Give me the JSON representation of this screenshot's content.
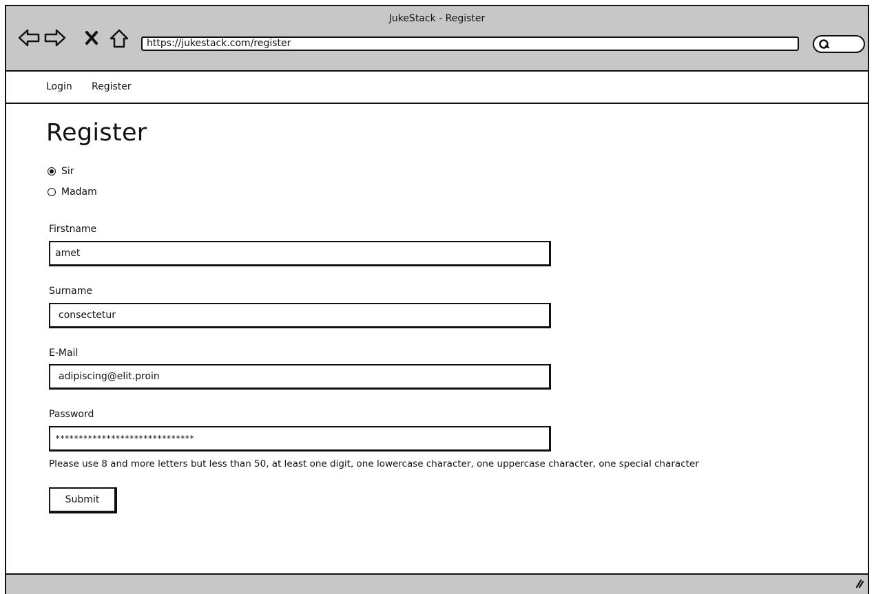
{
  "window": {
    "title": "JukeStack - Register"
  },
  "browser": {
    "back_icon": "arrow-left-outline",
    "forward_icon": "arrow-right-outline",
    "stop_icon": "x-mark",
    "home_icon": "house-outline",
    "url": "https://jukestack.com/register",
    "search_icon": "magnifier"
  },
  "nav": {
    "items": [
      {
        "label": "Login"
      },
      {
        "label": "Register"
      }
    ]
  },
  "form": {
    "title": "Register",
    "salutation": {
      "selected": "Sir",
      "options": [
        {
          "label": "Sir",
          "checked": true
        },
        {
          "label": "Madam",
          "checked": false
        }
      ]
    },
    "firstname": {
      "label": "Firstname",
      "value": "amet"
    },
    "surname": {
      "label": "Surname",
      "value": "consectetur"
    },
    "email": {
      "label": "E-Mail",
      "value": "adipiscing@elit.proin"
    },
    "password": {
      "label": "Password",
      "value": "******************************"
    },
    "password_hint": "Please use 8 and more letters but less than 50, at least one digit, one lowercase character, one uppercase character, one special character",
    "submit_label": "Submit"
  },
  "colors": {
    "chrome": "#c7c7c7",
    "border": "#111111",
    "page": "#ffffff"
  }
}
